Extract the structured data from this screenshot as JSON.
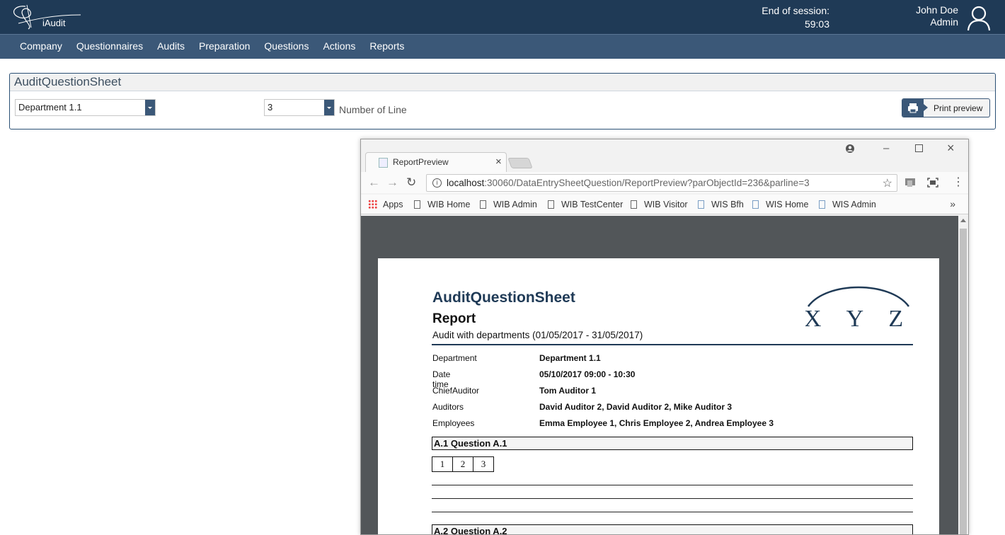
{
  "header": {
    "logo_text": "iAudit",
    "session_label": "End of session:",
    "session_time": "59:03",
    "user_name": "John Doe",
    "user_role": "Admin"
  },
  "nav": {
    "items": [
      "Company",
      "Questionnaires",
      "Audits",
      "Preparation",
      "Questions",
      "Actions",
      "Reports"
    ]
  },
  "panel": {
    "title": "AuditQuestionSheet",
    "department_value": "Department 1.1",
    "lines_value": "3",
    "lines_label": "Number of Line",
    "print_label": "Print preview"
  },
  "browser": {
    "tab_title": "ReportPreview",
    "url_host": "localhost",
    "url_rest": ":30060/DataEntrySheetQuestion/ReportPreview?parObjectId=236&parline=3",
    "bookmarks": [
      "Apps",
      "WIB Home",
      "WIB Admin",
      "WIB TestCenter",
      "WIB Visitor",
      "WIS Bfh",
      "WIS Home",
      "WIS Admin"
    ],
    "overflow": "»"
  },
  "report": {
    "title": "AuditQuestionSheet",
    "subtitle": "Report",
    "audit": "Audit with departments (01/05/2017 - 31/05/2017)",
    "logo_text": "X Y Z",
    "fields": [
      {
        "label": "Department",
        "value": "Department 1.1"
      },
      {
        "label": "Date time",
        "value": "05/10/2017 09:00 - 10:30"
      },
      {
        "label": "ChiefAuditor",
        "value": "Tom Auditor 1"
      },
      {
        "label": "Auditors",
        "value": "David Auditor 2, David Auditor 2, Mike Auditor 3"
      },
      {
        "label": "Employees",
        "value": "Emma Employee 1, Chris Employee 2, Andrea Employee 3"
      }
    ],
    "question1": "A.1 Question A.1",
    "numbers": [
      "1",
      "2",
      "3"
    ],
    "question2": "A.2 Question A.2"
  }
}
